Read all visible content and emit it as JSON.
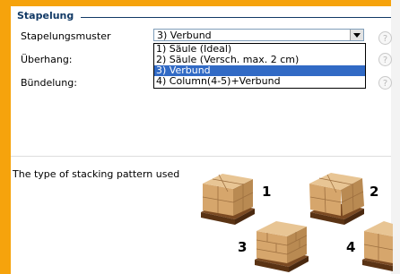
{
  "section": {
    "title": "Stapelung"
  },
  "fields": {
    "stapelungsmuster_label": "Stapelungsmuster",
    "ueberhang_label": "Überhang:",
    "buendelung_label": "Bündelung:"
  },
  "select": {
    "value": "3) Verbund",
    "options": [
      "1) Säule (Ideal)",
      "2) Säule (Versch. max. 2 cm)",
      "3) Verbund",
      "4) Column(4-5)+Verbund"
    ],
    "selected_index": 2
  },
  "help": {
    "symbol": "?"
  },
  "description": "The type of stacking pattern used",
  "illustration": {
    "labels": [
      "1",
      "2",
      "3",
      "4"
    ]
  },
  "colors": {
    "accent": "#f6a30c",
    "title": "#123a66",
    "highlight": "#316ac5"
  }
}
